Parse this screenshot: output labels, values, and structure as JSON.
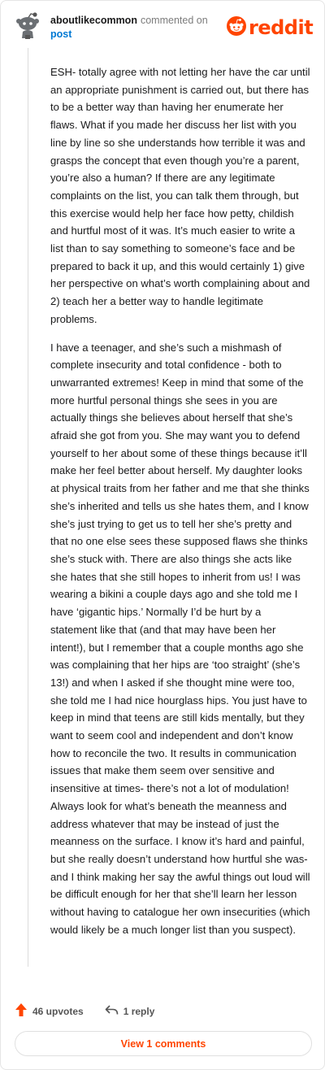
{
  "header": {
    "username": "aboutlikecommon",
    "action_text": "commented on",
    "post_link": "post",
    "avatar_icon": "snoo-avatar-icon",
    "logo_icon": "reddit-alien-icon",
    "brand_color": "#ff4500",
    "link_color": "#0079d3"
  },
  "comment": {
    "paragraphs": [
      "ESH- totally agree with not letting her have the car until an appropriate punishment is carried out, but there has to be a better way than having her enumerate her flaws. What if you made her discuss her list with you line by line so she understands how terrible it was and grasps the concept that even though you’re a parent, you’re also a human? If there are any legitimate complaints on the list, you can talk them through, but this exercise would help her face how petty, childish and hurtful most of it was. It’s much easier to write a list than to say something to someone’s face and be prepared to back it up, and this would certainly 1) give her perspective on what’s worth complaining about and 2) teach her a better way to handle legitimate problems.",
      "I have a teenager, and she’s such a mishmash of complete insecurity and total confidence - both to unwarranted extremes! Keep in mind that some of the more hurtful personal things she sees in you are actually things she believes about herself that she’s afraid she got from you. She may want you to defend yourself to her about some of these things because it’ll make her feel better about herself. My daughter looks at physical traits from her father and me that she thinks she’s inherited and tells us she hates them, and I know she’s just trying to get us to tell her she’s pretty and that no one else sees these supposed flaws she thinks she’s stuck with. There are also things she acts like she hates that she still hopes to inherit from us! I was wearing a bikini a couple days ago and she told me I have ‘gigantic hips.’ Normally I’d be hurt by a statement like that (and that may have been her intent!), but I remember that a couple months ago she was complaining that her hips are ‘too straight’ (she’s 13!) and when I asked if she thought mine were too, she told me I had nice hourglass hips. You just have to keep in mind that teens are still kids mentally, but they want to seem cool and independent and don’t know how to reconcile the two. It results in communication issues that make them seem over sensitive and insensitive at times- there’s not a lot of modulation! Always look for what’s beneath the meanness and address whatever that may be instead of just the meanness on the surface. I know it’s hard and painful, but she really doesn’t understand how hurtful she was- and I think making her say the awful things out loud will be difficult enough for her that she’ll learn her lesson without having to catalogue her own insecurities (which would likely be a much longer list than you suspect)."
    ]
  },
  "actions": {
    "upvotes": "46 upvotes",
    "replies": "1 reply",
    "upvote_icon": "upvote-arrow-icon",
    "reply_icon": "reply-arrow-icon"
  },
  "footer": {
    "view_comments": "View 1 comments"
  }
}
